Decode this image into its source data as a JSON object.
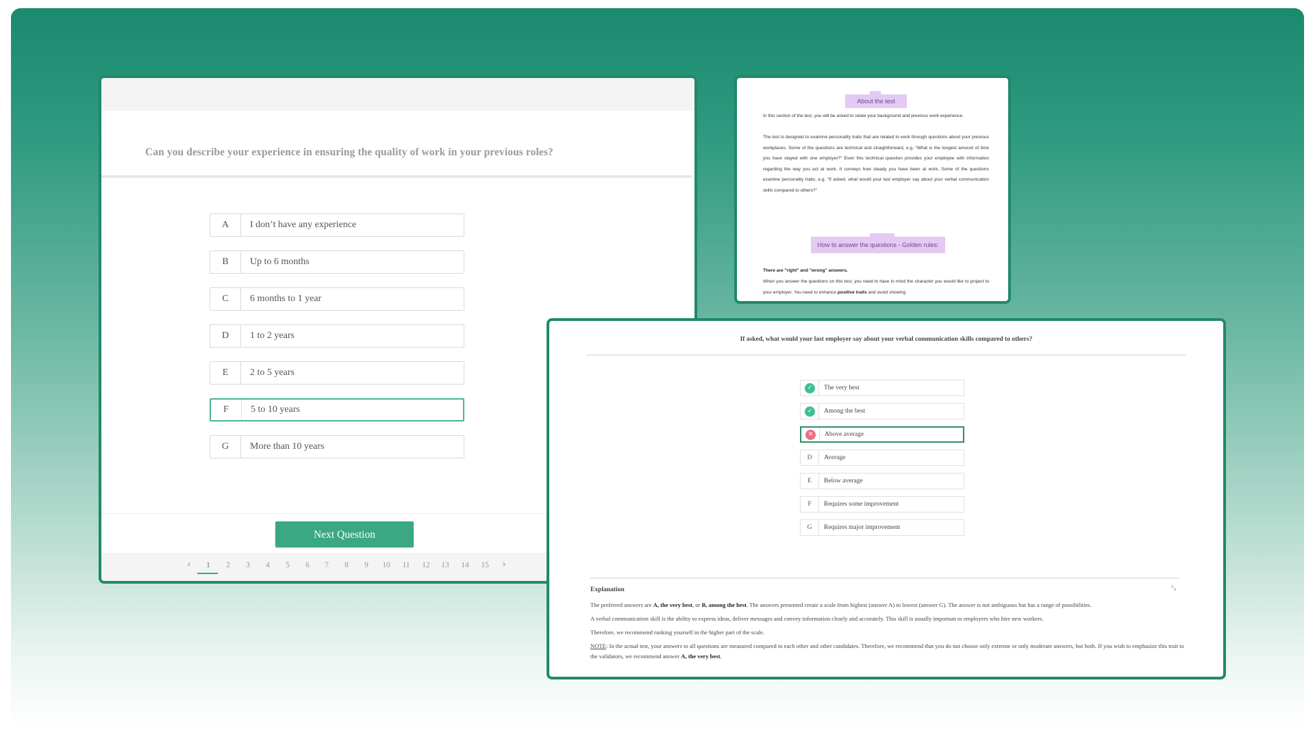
{
  "question_panel": {
    "question": "Can you describe your experience in ensuring the quality of work in your previous roles?",
    "options": [
      {
        "letter": "A",
        "text": "I don’t have any experience"
      },
      {
        "letter": "B",
        "text": "Up to 6 months"
      },
      {
        "letter": "C",
        "text": "6 months to 1 year"
      },
      {
        "letter": "D",
        "text": "1 to 2 years"
      },
      {
        "letter": "E",
        "text": "2 to 5 years"
      },
      {
        "letter": "F",
        "text": "5 to 10 years"
      },
      {
        "letter": "G",
        "text": "More than 10 years"
      }
    ],
    "selected_letter": "F",
    "next_button": "Next Question",
    "pager": {
      "prev_icon": "chevron-left-icon",
      "next_icon": "chevron-right-icon",
      "pages": [
        "1",
        "2",
        "3",
        "4",
        "5",
        "6",
        "7",
        "8",
        "9",
        "10",
        "11",
        "12",
        "13",
        "14",
        "15"
      ],
      "current_page": "1"
    }
  },
  "guide_panel": {
    "about_heading": "About the test",
    "about_paragraphs": [
      "In this section of the test, you will be asked to relate your background and previous work experience.",
      "The test is designed to examine personality traits that are related to work through questions about your previous workplaces. Some of the questions are technical and straightforward, e.g. “What is the longest amount of time you have stayed with one employer?” Even this technical question provides your employee with information regarding the way you act at work. It conveys how steady you have been at work. Some of the questions examine personality traits, e.g. “If asked, what would your last employer say about your verbal communication skills compared to others?”"
    ],
    "rules_heading": "How to answer the questions - Golden rules:",
    "rule_title": "There are \"right\" and \"wrong\" answers.",
    "rule_text_before": "When you answer the questions on this test, you need to have in mind the character you would like to project to your employer. You need to enhance ",
    "rule_text_bold": "positive traits",
    "rule_text_after": " and avoid showing"
  },
  "review_panel": {
    "question": "If asked, what would your last employer say about your verbal communication skills compared to others?",
    "options": [
      {
        "letter": "A",
        "text": "The very best",
        "status": "correct",
        "icon": "check-icon"
      },
      {
        "letter": "B",
        "text": "Among the best",
        "status": "correct",
        "icon": "check-icon"
      },
      {
        "letter": "C",
        "text": "Above average",
        "status": "wrong",
        "icon": "cross-icon"
      },
      {
        "letter": "D",
        "text": "Average",
        "status": "none"
      },
      {
        "letter": "E",
        "text": "Below average",
        "status": "none"
      },
      {
        "letter": "F",
        "text": "Requires some improvement",
        "status": "none"
      },
      {
        "letter": "G",
        "text": "Requires major improvement",
        "status": "none"
      }
    ],
    "explanation_title": "Explanation",
    "collapse_icon": "collapse-icon",
    "p1": {
      "t1": "The preferred answers are ",
      "b1": "A, the very best",
      "t2": ", or ",
      "b2": "B, among the best",
      "t3": ". The answers presented create a scale from highest (answer A) to lowest (answer G). The answer is not ambiguous but has a range of possibilities."
    },
    "p2": "A verbal communication skill is the ability to express ideas, deliver messages and convey information clearly and accurately. This skill is usually important to employers who hire new workers.",
    "p3": "Therefore, we recommend ranking yourself in the higher part of the scale.",
    "note": {
      "label": "NOTE",
      "text": ": In the actual test, your answers to all questions are measured compared to each other and other candidates. Therefore, we recommend that you do not choose only extreme or only moderate answers, but both. If you wish to emphasize this trait to the validators, we recommend answer ",
      "bold": "A, the very best",
      "end": "."
    }
  },
  "colors": {
    "accent": "#3aa883",
    "frame": "#21886b",
    "highlight": "#e3c9f3",
    "correct": "#3fbf93",
    "wrong": "#ea6f82"
  }
}
